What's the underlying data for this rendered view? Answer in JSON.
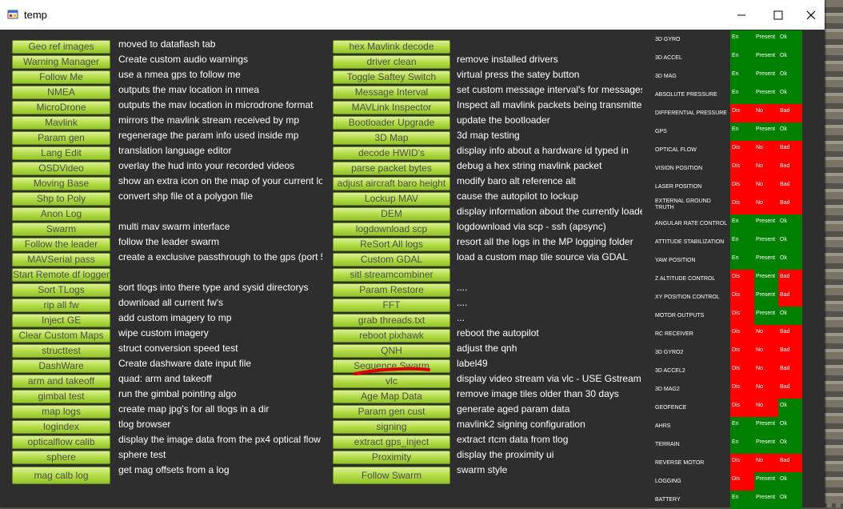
{
  "window": {
    "title": "temp"
  },
  "colors": {
    "button_green": "#b4dd47",
    "ok_green": "#008000",
    "bad_red": "#ff0000",
    "annotation_red": "#e00000",
    "panel_bg": "#2e2e2e"
  },
  "left": [
    {
      "button": "Geo ref images",
      "desc": "moved to dataflash tab"
    },
    {
      "button": "Warning Manager",
      "desc": "Create custom audio warnings"
    },
    {
      "button": "Follow Me",
      "desc": "use a nmea gps to follow me"
    },
    {
      "button": "NMEA",
      "desc": "outputs the mav location in nmea"
    },
    {
      "button": "MicroDrone",
      "desc": "outputs the mav location in microdrone format"
    },
    {
      "button": "Mavlink",
      "desc": "mirrors the mavlink stream received by mp"
    },
    {
      "button": "Param gen",
      "desc": "regenerage the param info used inside mp"
    },
    {
      "button": "Lang Edit",
      "desc": "translation language editor"
    },
    {
      "button": "OSDVideo",
      "desc": "overlay the hud into your recorded videos"
    },
    {
      "button": "Moving Base",
      "desc": "show an extra icon on the map of your current location"
    },
    {
      "button": "Shp to Poly",
      "desc": "convert shp file ot a polygon file"
    },
    {
      "button": "Anon Log",
      "desc": ""
    },
    {
      "button": "Swarm",
      "desc": "multi mav swarm interface"
    },
    {
      "button": "Follow the leader",
      "desc": "follow the leader swarm"
    },
    {
      "button": "MAVSerial pass",
      "desc": "create a exclusive passthrough to the gps (port 500)"
    },
    {
      "button": "Start Remote df logger",
      "desc": ""
    },
    {
      "button": "Sort TLogs",
      "desc": "sort tlogs into there type and sysid directorys"
    },
    {
      "button": "rip all fw",
      "desc": "download all current fw's"
    },
    {
      "button": "Inject GE",
      "desc": "add custom imagery to mp"
    },
    {
      "button": "Clear Custom Maps",
      "desc": "wipe custom imagery"
    },
    {
      "button": "structtest",
      "desc": "struct conversion speed test"
    },
    {
      "button": "DashWare",
      "desc": "Create dashware date input file"
    },
    {
      "button": "arm and takeoff",
      "desc": "quad: arm and takeoff"
    },
    {
      "button": "gimbal test",
      "desc": "run the gimbal pointing algo"
    },
    {
      "button": "map logs",
      "desc": "create map jpg's for all tlogs in a dir"
    },
    {
      "button": "logindex",
      "desc": "tlog browser"
    },
    {
      "button": "opticalflow calib",
      "desc": "display the image data from the px4 optical flow sensor"
    },
    {
      "button": "sphere",
      "desc": "sphere test"
    },
    {
      "button": "mag calb log",
      "desc": "get mag offsets from a log"
    }
  ],
  "middle": [
    {
      "button": "hex Mavlink decode",
      "desc": ""
    },
    {
      "button": "driver clean",
      "desc": "remove installed drivers"
    },
    {
      "button": "Toggle Saftey Switch",
      "desc": "virtual press the satey button"
    },
    {
      "button": "Message Interval",
      "desc": "set custom message interval's for messages"
    },
    {
      "button": "MAVLink Inspector",
      "desc": "Inspect all mavlink packets being transmitted"
    },
    {
      "button": "Bootloader Upgrade",
      "desc": "update the bootloader"
    },
    {
      "button": "3D Map",
      "desc": "3d map testing"
    },
    {
      "button": "decode HWID's",
      "desc": "display info about a hardware id typed in"
    },
    {
      "button": "parse packet bytes",
      "desc": "debug a hex string mavlink packet"
    },
    {
      "button": "adjust aircraft baro height",
      "desc": "modify baro alt reference alt"
    },
    {
      "button": "Lockup MAV",
      "desc": "cause the autopilot to lockup"
    },
    {
      "button": "DEM",
      "desc": "display information about the currently loaded DEM's"
    },
    {
      "button": "logdownload scp",
      "desc": "logdownload via scp - ssh (apsync)"
    },
    {
      "button": "ReSort All logs",
      "desc": "resort all the logs in the MP logging folder"
    },
    {
      "button": "Custom GDAL",
      "desc": "load a custom map tile source via GDAL"
    },
    {
      "button": "sitl streamcombiner",
      "desc": ""
    },
    {
      "button": "Param Restore",
      "desc": "...."
    },
    {
      "button": "FFT",
      "desc": "...."
    },
    {
      "button": "grab threads.txt",
      "desc": "..."
    },
    {
      "button": "reboot pixhawk",
      "desc": "reboot the autopilot"
    },
    {
      "button": "QNH",
      "desc": "adjust the qnh"
    },
    {
      "button": "Sequence Swarm",
      "desc": "label49"
    },
    {
      "button": "vlc",
      "desc": "display video stream via vlc - USE Gstream instead"
    },
    {
      "button": "Age Map Data",
      "desc": "remove image tiles older than 30 days"
    },
    {
      "button": "Param gen cust",
      "desc": "generate aged param data"
    },
    {
      "button": "signing",
      "desc": "mavlink2 signing configuration"
    },
    {
      "button": "extract gps_inject",
      "desc": "extract rtcm data from tlog"
    },
    {
      "button": "Proximity",
      "desc": "display the proximity ui"
    },
    {
      "button": "Follow Swarm",
      "desc": "swarm style"
    }
  ],
  "sensors": [
    {
      "name": "3D GYRO",
      "enabled": "En",
      "present": "Present",
      "health": "Ok"
    },
    {
      "name": "3D ACCEL",
      "enabled": "En",
      "present": "Present",
      "health": "Ok"
    },
    {
      "name": "3D MAG",
      "enabled": "En",
      "present": "Present",
      "health": "Ok"
    },
    {
      "name": "ABSOLUTE PRESSURE",
      "enabled": "En",
      "present": "Present",
      "health": "Ok"
    },
    {
      "name": "DIFFERENTIAL PRESSURE",
      "enabled": "Dis",
      "present": "No",
      "health": "Bad"
    },
    {
      "name": "GPS",
      "enabled": "En",
      "present": "Present",
      "health": "Ok"
    },
    {
      "name": "OPTICAL FLOW",
      "enabled": "Dis",
      "present": "No",
      "health": "Bad"
    },
    {
      "name": "VISION POSITION",
      "enabled": "Dis",
      "present": "No",
      "health": "Bad"
    },
    {
      "name": "LASER POSITION",
      "enabled": "Dis",
      "present": "No",
      "health": "Bad"
    },
    {
      "name": "EXTERNAL GROUND TRUTH",
      "enabled": "Dis",
      "present": "No",
      "health": "Bad"
    },
    {
      "name": "ANGULAR RATE CONTROL",
      "enabled": "En",
      "present": "Present",
      "health": "Ok"
    },
    {
      "name": "ATTITUDE STABILIZATION",
      "enabled": "En",
      "present": "Present",
      "health": "Ok"
    },
    {
      "name": "YAW POSITION",
      "enabled": "En",
      "present": "Present",
      "health": "Ok"
    },
    {
      "name": "Z ALTITUDE CONTROL",
      "enabled": "Dis",
      "present": "Present",
      "health": "Bad"
    },
    {
      "name": "XY POSITION CONTROL",
      "enabled": "Dis",
      "present": "Present",
      "health": "Bad"
    },
    {
      "name": "MOTOR OUTPUTS",
      "enabled": "Dis",
      "present": "Present",
      "health": "Ok"
    },
    {
      "name": "RC RECEIVER",
      "enabled": "Dis",
      "present": "No",
      "health": "Bad"
    },
    {
      "name": "3D GYRO2",
      "enabled": "Dis",
      "present": "No",
      "health": "Bad"
    },
    {
      "name": "3D ACCEL2",
      "enabled": "Dis",
      "present": "No",
      "health": "Bad"
    },
    {
      "name": "3D MAG2",
      "enabled": "Dis",
      "present": "No",
      "health": "Bad"
    },
    {
      "name": "GEOFENCE",
      "enabled": "Dis",
      "present": "No",
      "health": "Ok"
    },
    {
      "name": "AHRS",
      "enabled": "En",
      "present": "Present",
      "health": "Ok"
    },
    {
      "name": "TERRAIN",
      "enabled": "En",
      "present": "Present",
      "health": "Ok"
    },
    {
      "name": "REVERSE MOTOR",
      "enabled": "Dis",
      "present": "No",
      "health": "Bad"
    },
    {
      "name": "LOGGING",
      "enabled": "Dis",
      "present": "Present",
      "health": "Ok"
    },
    {
      "name": "BATTERY",
      "enabled": "En",
      "present": "Present",
      "health": "Ok"
    }
  ]
}
